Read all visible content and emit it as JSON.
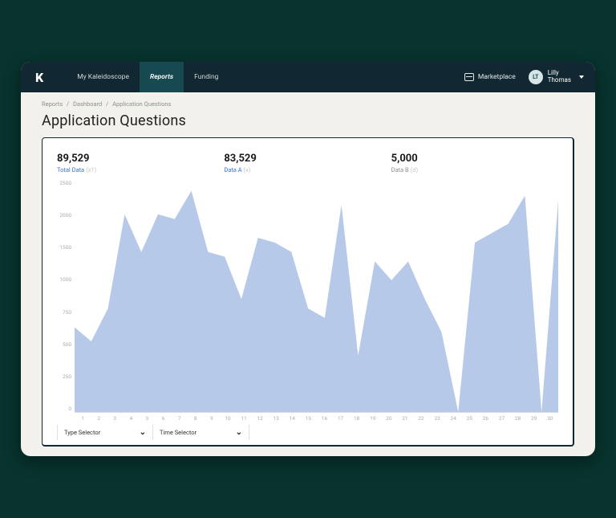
{
  "nav": {
    "logo": "K",
    "tabs": [
      "My Kaleidoscope",
      "Reports",
      "Funding"
    ],
    "active_tab": 1,
    "marketplace_label": "Marketplace",
    "user": {
      "initials": "LT",
      "name_line1": "Lilly",
      "name_line2": "Thomas"
    }
  },
  "breadcrumb": [
    "Reports",
    "Dashboard",
    "Application Questions"
  ],
  "page_title": "Application Questions",
  "stats": [
    {
      "value": "89,529",
      "label": "Total Data",
      "sub": "(x1)",
      "link": true
    },
    {
      "value": "83,529",
      "label": "Data A",
      "sub": "(x)",
      "link": true
    },
    {
      "value": "5,000",
      "label": "Data B",
      "sub": "(d)",
      "link": false
    }
  ],
  "selectors": {
    "type": "Type Selector",
    "time": "Time Selector"
  },
  "chart_data": {
    "type": "area",
    "title": "Application Questions",
    "xlabel": "",
    "ylabel": "",
    "ylim": [
      0,
      2500
    ],
    "y_ticks": [
      2500,
      2000,
      1500,
      1000,
      750,
      500,
      250,
      0
    ],
    "x": [
      1,
      2,
      3,
      4,
      5,
      6,
      7,
      8,
      9,
      10,
      11,
      12,
      13,
      14,
      15,
      16,
      17,
      18,
      19,
      20,
      21,
      22,
      23,
      24,
      25,
      26,
      27,
      28,
      29,
      30
    ],
    "series": [
      {
        "name": "Data",
        "color": "#b7c9e8",
        "values": [
          900,
          750,
          1100,
          2100,
          1700,
          2100,
          2050,
          2350,
          1700,
          1650,
          1200,
          1850,
          1800,
          1700,
          1100,
          1000,
          2200,
          600,
          1600,
          1400,
          1600,
          1200,
          850,
          0,
          1800,
          1900,
          2000,
          2300,
          0,
          2250
        ]
      }
    ]
  }
}
